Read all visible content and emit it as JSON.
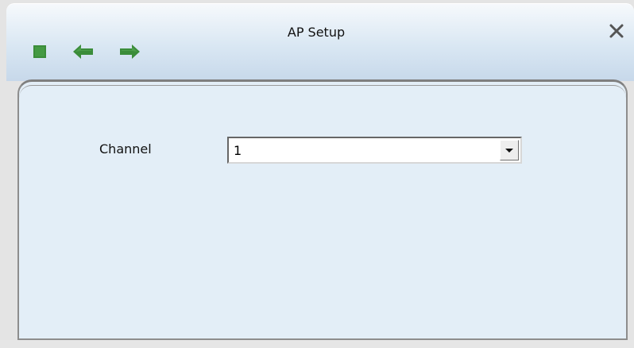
{
  "window": {
    "title": "AP Setup",
    "close_icon": "close-icon",
    "toolbar_icons": [
      {
        "name": "stop-icon",
        "color": "#3b8d3a"
      },
      {
        "name": "back-arrow-icon",
        "color": "#3b8d3a"
      },
      {
        "name": "forward-arrow-icon",
        "color": "#3b8d3a"
      }
    ]
  },
  "form": {
    "channel_label": "Channel",
    "channel_value": "1",
    "dropdown_icon": "chevron-down-icon"
  },
  "colors": {
    "panel_background": "#e3eef7",
    "title_gradient_start": "#f6f9fc",
    "title_gradient_end": "#c7d8ea",
    "icon_green": "#3b8d3a"
  }
}
